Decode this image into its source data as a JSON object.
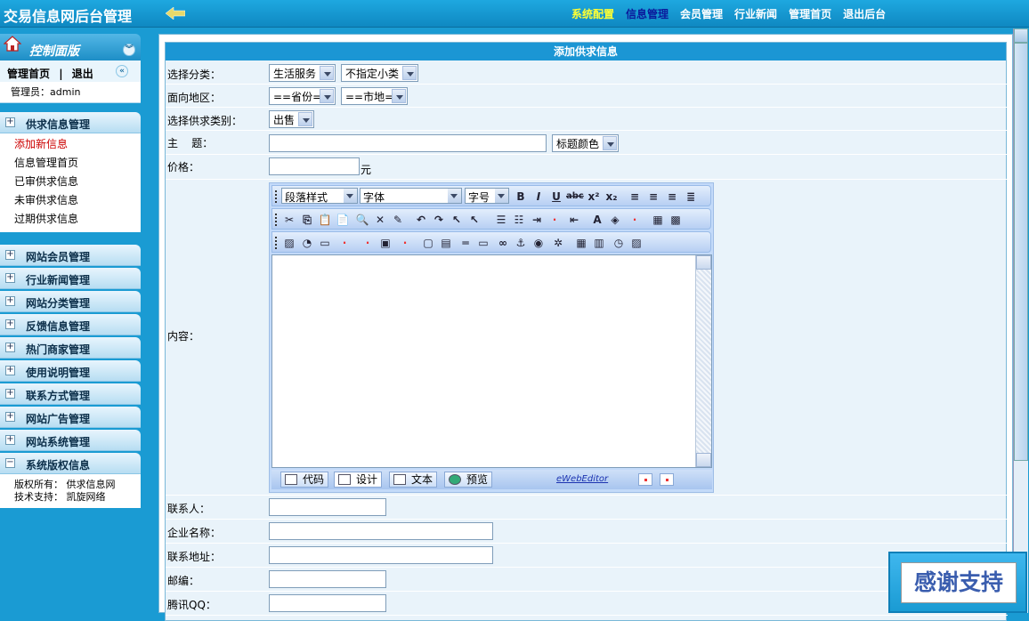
{
  "header": {
    "title": "交易信息网后台管理",
    "nav": [
      {
        "label": "系统配置"
      },
      {
        "label": "信息管理"
      },
      {
        "label": "会员管理"
      },
      {
        "label": "行业新闻"
      },
      {
        "label": "管理首页"
      },
      {
        "label": "退出后台"
      }
    ]
  },
  "sidebar": {
    "panel_title": "控制面版",
    "home_link": "管理首页",
    "sep": "|",
    "logout_link": "退出",
    "admin_text": "管理员：admin",
    "groups": [
      {
        "label": "供求信息管理",
        "expanded": true,
        "items": [
          "添加新信息",
          "信息管理首页",
          "已审供求信息",
          "未审供求信息",
          "过期供求信息"
        ]
      },
      {
        "label": "网站会员管理"
      },
      {
        "label": "行业新闻管理"
      },
      {
        "label": "网站分类管理"
      },
      {
        "label": "反馈信息管理"
      },
      {
        "label": "热门商家管理"
      },
      {
        "label": "使用说明管理"
      },
      {
        "label": "联系方式管理"
      },
      {
        "label": "网站广告管理"
      },
      {
        "label": "网站系统管理"
      },
      {
        "label": "系统版权信息",
        "expanded": true
      }
    ],
    "copyright": {
      "line1": "版权所有： 供求信息网",
      "line2": "技术支持： 凯旋网络"
    }
  },
  "form": {
    "title": "添加供求信息",
    "category_label": "选择分类：",
    "category_value": "生活服务",
    "subcategory_value": "不指定小类",
    "region_label": "面向地区：",
    "province_value": "==省份==",
    "city_value": "==市地==",
    "type_label": "选择供求类别：",
    "type_value": "出售",
    "subject_label": "主    题：",
    "subject_value": "",
    "title_color_value": "标题颜色",
    "price_label": "价格：",
    "price_unit": "元",
    "content_label": "内容：",
    "contact_label": "联系人：",
    "company_label": "企业名称：",
    "address_label": "联系地址：",
    "postcode_label": "邮编：",
    "qq_label": "腾讯QQ："
  },
  "editor": {
    "paragraph_style": "段落样式",
    "font": "字体",
    "font_size": "字号",
    "tab_code": "代码",
    "tab_design": "设计",
    "tab_text": "文本",
    "tab_preview": "预览",
    "brand": "eWebEditor"
  },
  "badge": {
    "text": "感谢支持"
  },
  "colors": {
    "sidebar_bg": "#1a9bd3",
    "nav_highlight": "#ffff33",
    "nav_current": "#0b1a9c",
    "panel_header": "#1b96d4"
  }
}
